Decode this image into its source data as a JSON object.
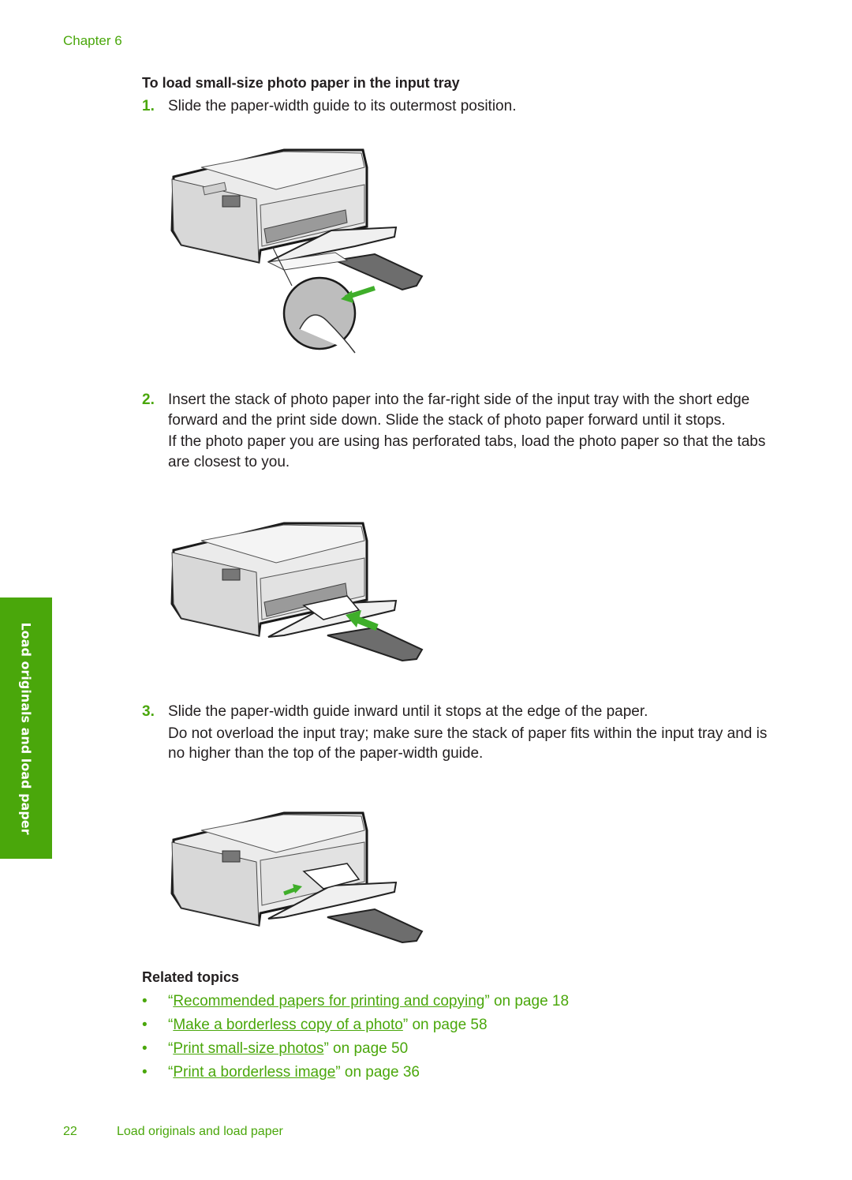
{
  "header": {
    "chapter": "Chapter 6"
  },
  "procedure": {
    "title": "To load small-size photo paper in the input tray",
    "steps": [
      {
        "number": "1.",
        "paragraphs": [
          "Slide the paper-width guide to its outermost position."
        ]
      },
      {
        "number": "2.",
        "paragraphs": [
          "Insert the stack of photo paper into the far-right side of the input tray with the short edge forward and the print side down. Slide the stack of photo paper forward until it stops.",
          "If the photo paper you are using has perforated tabs, load the photo paper so that the tabs are closest to you."
        ]
      },
      {
        "number": "3.",
        "paragraphs": [
          "Slide the paper-width guide inward until it stops at the edge of the paper.",
          "Do not overload the input tray; make sure the stack of paper fits within the input tray and is no higher than the top of the paper-width guide."
        ]
      }
    ]
  },
  "illustrations": [
    {
      "name": "printer-guide-outward-illustration",
      "arrow": "outward",
      "inset": "hand-sliding-guide"
    },
    {
      "name": "printer-insert-paper-illustration",
      "arrow": "inward-paper"
    },
    {
      "name": "printer-guide-inward-illustration",
      "arrow": "guide-inward"
    }
  ],
  "side_tab": {
    "label": "Load originals and load paper"
  },
  "related": {
    "title": "Related topics",
    "items": [
      {
        "bullet": "•",
        "open_quote": "“",
        "link": "Recommended papers for printing and copying",
        "suffix": "” on page 18"
      },
      {
        "bullet": "•",
        "open_quote": "“",
        "link": "Make a borderless copy of a photo",
        "suffix": "” on page 58"
      },
      {
        "bullet": "•",
        "open_quote": "“",
        "link": "Print small-size photos",
        "suffix": "” on page 50"
      },
      {
        "bullet": "•",
        "open_quote": "“",
        "link": "Print a borderless image",
        "suffix": "” on page 36"
      }
    ]
  },
  "footer": {
    "page_number": "22",
    "section_title": "Load originals and load paper"
  },
  "colors": {
    "accent": "#4aa70b",
    "text": "#231f20",
    "arrow": "#3fae2a"
  }
}
